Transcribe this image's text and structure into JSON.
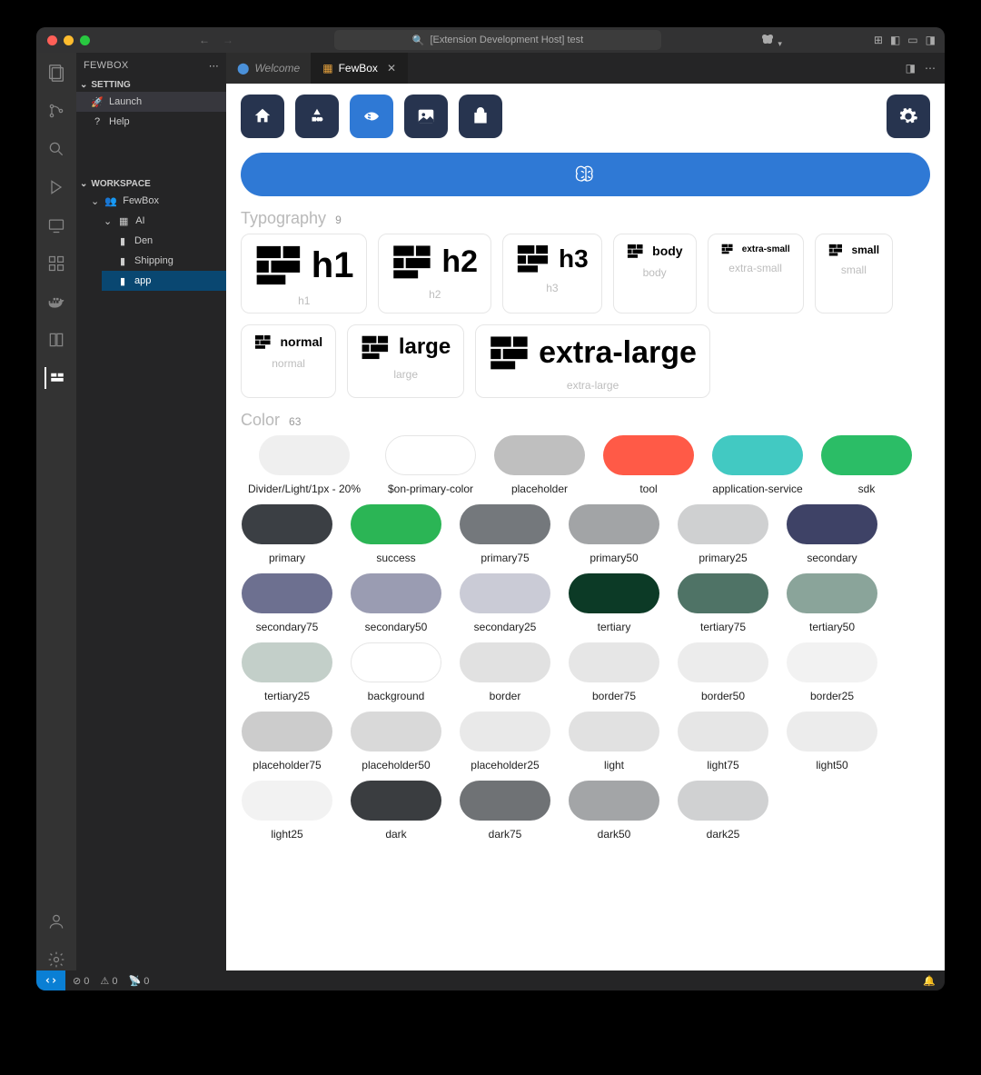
{
  "titlebar": {
    "search": "[Extension Development Host] test"
  },
  "sidebar": {
    "title": "FEWBOX",
    "sections": {
      "setting": {
        "label": "SETTING",
        "launch": "Launch",
        "help": "Help"
      },
      "workspace": {
        "label": "WORKSPACE",
        "root": "FewBox",
        "ai": "AI",
        "items": {
          "den": "Den",
          "shipping": "Shipping",
          "app": "app"
        }
      }
    }
  },
  "tabs": {
    "welcome": "Welcome",
    "fewbox": "FewBox"
  },
  "typography": {
    "title": "Typography",
    "count": "9",
    "items": [
      {
        "name": "h1",
        "label": "h1",
        "size": 40
      },
      {
        "name": "h2",
        "label": "h2",
        "size": 34
      },
      {
        "name": "h3",
        "label": "h3",
        "size": 28
      },
      {
        "name": "body",
        "label": "body",
        "size": 14
      },
      {
        "name": "extra-small",
        "label": "extra-small",
        "size": 10
      },
      {
        "name": "small",
        "label": "small",
        "size": 12
      },
      {
        "name": "normal",
        "label": "normal",
        "size": 14
      },
      {
        "name": "large",
        "label": "large",
        "size": 24
      },
      {
        "name": "extra-large",
        "label": "extra-large",
        "size": 34
      }
    ]
  },
  "color": {
    "title": "Color",
    "count": "63",
    "items": [
      {
        "label": "Divider/Light/1px - 20%",
        "hex": "#efefef",
        "wide": true
      },
      {
        "label": "$on-primary-color",
        "hex": "#ffffff",
        "bordered": true
      },
      {
        "label": "placeholder",
        "hex": "#bfbfbf"
      },
      {
        "label": "tool",
        "hex": "#ff5a47"
      },
      {
        "label": "application-service",
        "hex": "#42c9c2"
      },
      {
        "label": "sdk",
        "hex": "#2bbd66"
      },
      {
        "label": "primary",
        "hex": "#3b3f44"
      },
      {
        "label": "success",
        "hex": "#2bb555"
      },
      {
        "label": "primary75",
        "hex": "#74787c"
      },
      {
        "label": "primary50",
        "hex": "#a2a4a6"
      },
      {
        "label": "primary25",
        "hex": "#cfd0d1"
      },
      {
        "label": "secondary",
        "hex": "#3e4266"
      },
      {
        "label": "secondary75",
        "hex": "#6d7090"
      },
      {
        "label": "secondary50",
        "hex": "#9a9cb2"
      },
      {
        "label": "secondary25",
        "hex": "#cacbd6"
      },
      {
        "label": "tertiary",
        "hex": "#0c3a26"
      },
      {
        "label": "tertiary75",
        "hex": "#4f7366"
      },
      {
        "label": "tertiary50",
        "hex": "#8aa49a"
      },
      {
        "label": "tertiary25",
        "hex": "#c3cfc9"
      },
      {
        "label": "background",
        "hex": "#ffffff",
        "bordered": true
      },
      {
        "label": "border",
        "hex": "#e1e1e1"
      },
      {
        "label": "border75",
        "hex": "#e6e6e6"
      },
      {
        "label": "border50",
        "hex": "#ececec"
      },
      {
        "label": "border25",
        "hex": "#f2f2f2"
      },
      {
        "label": "placeholder75",
        "hex": "#cccccc"
      },
      {
        "label": "placeholder50",
        "hex": "#d9d9d9"
      },
      {
        "label": "placeholder25",
        "hex": "#e9e9e9"
      },
      {
        "label": "light",
        "hex": "#e1e1e1"
      },
      {
        "label": "light75",
        "hex": "#e6e6e6"
      },
      {
        "label": "light50",
        "hex": "#ececec"
      },
      {
        "label": "light25",
        "hex": "#f2f2f2"
      },
      {
        "label": "dark",
        "hex": "#3a3d40"
      },
      {
        "label": "dark75",
        "hex": "#6f7275"
      },
      {
        "label": "dark50",
        "hex": "#a3a5a7"
      },
      {
        "label": "dark25",
        "hex": "#d0d1d2"
      }
    ]
  },
  "statusbar": {
    "errors": "0",
    "warnings": "0",
    "port": "0"
  }
}
